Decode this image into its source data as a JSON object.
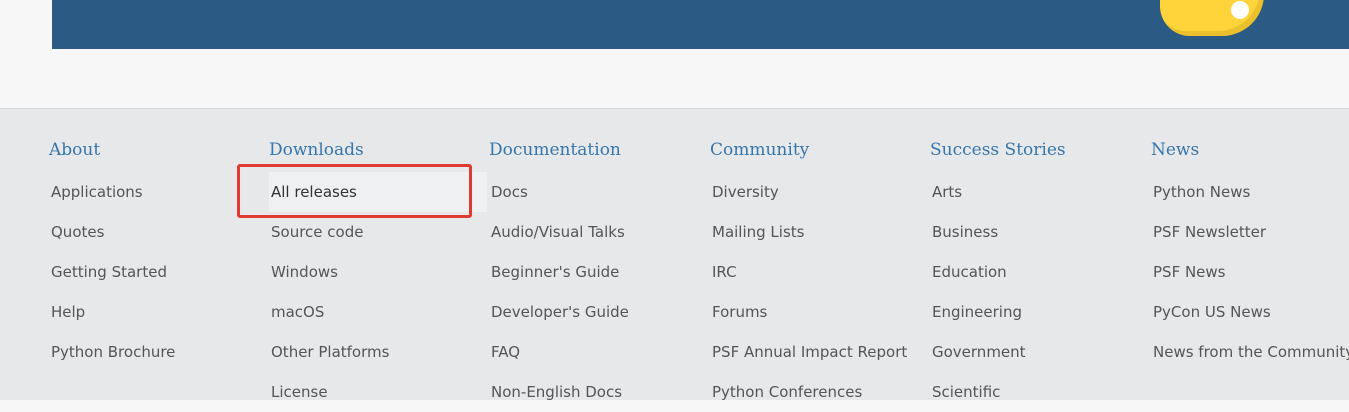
{
  "banner": {
    "logo_icon": "python-logo-icon"
  },
  "footer": {
    "columns": [
      {
        "title": "About",
        "items": [
          "Applications",
          "Quotes",
          "Getting Started",
          "Help",
          "Python Brochure"
        ]
      },
      {
        "title": "Downloads",
        "items": [
          "All releases",
          "Source code",
          "Windows",
          "macOS",
          "Other Platforms",
          "License"
        ]
      },
      {
        "title": "Documentation",
        "items": [
          "Docs",
          "Audio/Visual Talks",
          "Beginner's Guide",
          "Developer's Guide",
          "FAQ",
          "Non-English Docs"
        ]
      },
      {
        "title": "Community",
        "items": [
          "Diversity",
          "Mailing Lists",
          "IRC",
          "Forums",
          "PSF Annual Impact Report",
          "Python Conferences"
        ]
      },
      {
        "title": "Success Stories",
        "items": [
          "Arts",
          "Business",
          "Education",
          "Engineering",
          "Government",
          "Scientific"
        ]
      },
      {
        "title": "News",
        "items": [
          "Python News",
          "PSF Newsletter",
          "PSF News",
          "PyCon US News",
          "News from the Community"
        ]
      }
    ]
  },
  "colors": {
    "banner": "#2b5b84",
    "heading": "#3776ab",
    "highlight": "#e03a31",
    "logo": "#ffd43b"
  }
}
